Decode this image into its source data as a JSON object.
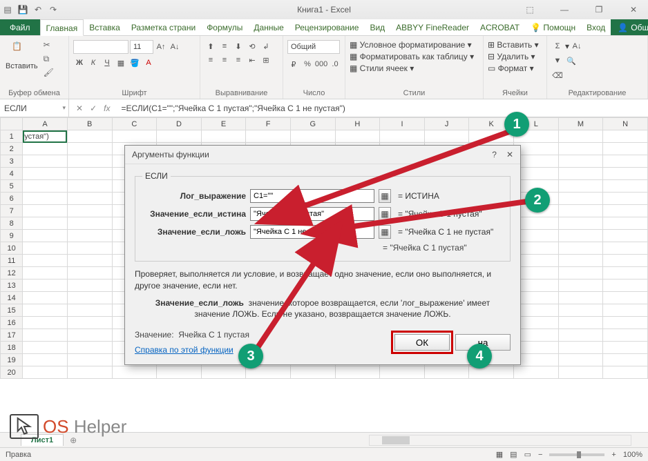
{
  "app": {
    "title": "Книга1 - Excel"
  },
  "qat": {
    "save": "💾",
    "undo": "↶",
    "redo": "↷"
  },
  "win": {
    "ribbon_opts": "⬚",
    "min": "—",
    "max": "❐",
    "close": "✕"
  },
  "tabs": {
    "file": "Файл",
    "home": "Главная",
    "insert": "Вставка",
    "layout": "Разметка страни",
    "formulas": "Формулы",
    "data": "Данные",
    "review": "Рецензирование",
    "view": "Вид",
    "abbyy": "ABBYY FineReader",
    "acrobat": "ACROBAT",
    "help": "Помощн",
    "login": "Вход",
    "share": "Общий доступ"
  },
  "ribbon": {
    "clipboard": {
      "label": "Буфер обмена",
      "paste": "Вставить"
    },
    "font": {
      "label": "Шрифт",
      "name": "",
      "size": "11"
    },
    "align": {
      "label": "Выравнивание"
    },
    "number": {
      "label": "Число",
      "format": "Общий"
    },
    "styles": {
      "label": "Стили",
      "cond": "Условное форматирование",
      "table": "Форматировать как таблицу",
      "cell": "Стили ячеек"
    },
    "cells": {
      "label": "Ячейки",
      "insert": "Вставить",
      "delete": "Удалить",
      "format": "Формат"
    },
    "editing": {
      "label": "Редактирование"
    }
  },
  "namebox": "ЕСЛИ",
  "formula": "=ЕСЛИ(C1=\"\";\"Ячейка С 1 пустая\";\"Ячейка С 1 не пустая\")",
  "columns": [
    "",
    "A",
    "B",
    "C",
    "D",
    "E",
    "F",
    "G",
    "H",
    "I",
    "J",
    "K",
    "L",
    "M",
    "N"
  ],
  "cellA1": "устая\")",
  "dialog": {
    "title": "Аргументы функции",
    "func": "ЕСЛИ",
    "args": {
      "log": {
        "label": "Лог_выражение",
        "value": "C1=\"\"",
        "result": "ИСТИНА"
      },
      "true": {
        "label": "Значение_если_истина",
        "value": "\"Ячейка С 1 пустая\"",
        "result": "\"Ячейка С 1 пустая\""
      },
      "false": {
        "label": "Значение_если_ложь",
        "value": "\"Ячейка С 1 не пустая\"",
        "result": "\"Ячейка С 1 не пустая\""
      }
    },
    "overall_result": "\"Ячейка С 1 пустая\"",
    "desc": "Проверяет, выполняется ли условие, и возвращает одно значение, если оно выполняется, и другое значение, если нет.",
    "arg_name": "Значение_если_ложь",
    "arg_desc": "значение, которое возвращается, если 'лог_выражение' имеет значение ЛОЖЬ. Если не указано, возвращается значение ЛОЖЬ.",
    "value_label": "Значение:",
    "value": "Ячейка С 1 пустая",
    "help_link": "Справка по этой функции",
    "ok": "ОК",
    "cancel": "на"
  },
  "sheet_tab": "Лист1",
  "status": {
    "left": "Правка",
    "zoom": "100%"
  },
  "badges": {
    "b1": "1",
    "b2": "2",
    "b3": "3",
    "b4": "4"
  },
  "logo": {
    "os": "OS",
    "helper": "Helper"
  }
}
